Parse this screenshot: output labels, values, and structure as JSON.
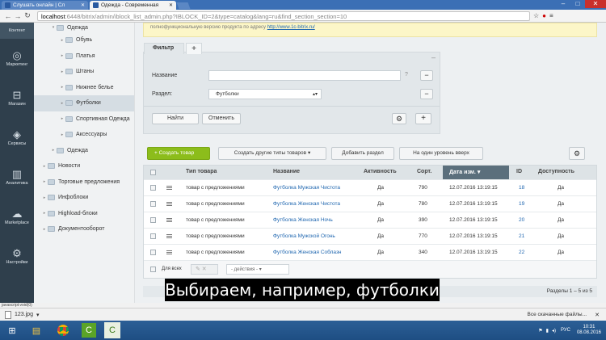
{
  "browser": {
    "tabs": [
      {
        "label": "Слушать онлайн | Сл",
        "active": false
      },
      {
        "label": "Одежда - Современная",
        "active": true
      }
    ],
    "url": "localhost:6448/bitrix/admin/iblock_list_admin.php?IBLOCK_ID=2&type=catalog&lang=ru&find_section_section=10",
    "url_host": "localhost",
    "url_rest": ":6448/bitrix/admin/iblock_list_admin.php?IBLOCK_ID=2&type=catalog&lang=ru&find_section_section=10"
  },
  "sidebar": {
    "items": [
      {
        "label": "Контент",
        "icon": "content-icon"
      },
      {
        "label": "Маркетинг",
        "icon": "target-icon"
      },
      {
        "label": "Магазин",
        "icon": "cart-icon"
      },
      {
        "label": "Сервисы",
        "icon": "layers-icon"
      },
      {
        "label": "Аналитика",
        "icon": "bar-chart-icon"
      },
      {
        "label": "Marketplace",
        "icon": "cloud-icon"
      },
      {
        "label": "Настройки",
        "icon": "gear-icon"
      }
    ]
  },
  "tree": {
    "items": [
      {
        "label": "Одежда",
        "indent": 2,
        "arrow": "▾"
      },
      {
        "label": "Обувь",
        "indent": 3,
        "arrow": "▸"
      },
      {
        "label": "Платья",
        "indent": 3,
        "arrow": "▸"
      },
      {
        "label": "Штаны",
        "indent": 3,
        "arrow": "▸"
      },
      {
        "label": "Нижнее белье",
        "indent": 3,
        "arrow": "▸"
      },
      {
        "label": "Футболки",
        "indent": 3,
        "arrow": "▸",
        "selected": true
      },
      {
        "label": "Спортивная Одежда",
        "indent": 3,
        "arrow": "▸"
      },
      {
        "label": "Аксессуары",
        "indent": 3,
        "arrow": "▸"
      },
      {
        "label": "Одежда",
        "indent": 2,
        "arrow": "▸"
      },
      {
        "label": "Новости",
        "indent": 1,
        "arrow": "▸"
      },
      {
        "label": "Торговые предложения",
        "indent": 1,
        "arrow": "▸"
      },
      {
        "label": "Инфоблоки",
        "indent": 1,
        "arrow": "▸"
      },
      {
        "label": "Highload-блоки",
        "indent": 1,
        "arrow": "▸"
      },
      {
        "label": "Документооборот",
        "indent": 1,
        "arrow": "▸"
      }
    ]
  },
  "notice": {
    "text": "полнофункциональную версию продукта по адресу",
    "link": "http://www.1c-bitrix.ru/"
  },
  "filter": {
    "tab_label": "Фильтр",
    "add_tab": "+",
    "name_label": "Название",
    "name_value": "",
    "help": "?",
    "section_label": "Раздел:",
    "section_value": "Футболки",
    "find_button": "Найти",
    "cancel_button": "Отменить",
    "remove": "−",
    "add": "+"
  },
  "toolbar": {
    "create": "Создать товар",
    "create_other": "Создать другие типы товаров",
    "add_section": "Добавить раздел",
    "level_up": "На один уровень вверх"
  },
  "grid": {
    "columns": [
      "Тип товара",
      "Название",
      "Активность",
      "Сорт.",
      "Дата изм.",
      "ID",
      "Доступность"
    ],
    "rows": [
      {
        "type": "товар с предложениями",
        "name": "Футболка Мужская Чистота",
        "active": "Да",
        "sort": "790",
        "date": "12.07.2016 13:19:15",
        "id": "18",
        "avail": "Да"
      },
      {
        "type": "товар с предложениями",
        "name": "Футболка Женская Чистота",
        "active": "Да",
        "sort": "780",
        "date": "12.07.2016 13:19:15",
        "id": "19",
        "avail": "Да"
      },
      {
        "type": "товар с предложениями",
        "name": "Футболка Женская Ночь",
        "active": "Да",
        "sort": "390",
        "date": "12.07.2016 13:19:15",
        "id": "20",
        "avail": "Да"
      },
      {
        "type": "товар с предложениями",
        "name": "Футболка Мужской Огонь",
        "active": "Да",
        "sort": "770",
        "date": "12.07.2016 13:19:15",
        "id": "21",
        "avail": "Да"
      },
      {
        "type": "товар с предложениями",
        "name": "Футболка Женская Соблазн",
        "active": "Да",
        "sort": "340",
        "date": "12.07.2016 13:19:15",
        "id": "22",
        "avail": "Да"
      }
    ],
    "for_all": "Для всех",
    "actions": "- действия -",
    "pager": "Разделы 1 – 5 из 5"
  },
  "subtitle": "Выбираем, например, футболки",
  "status": "javascript:void(0)",
  "download": {
    "file": "123.jpg",
    "all": "Все скачанные файлы..."
  },
  "taskbar": {
    "lang": "РУС",
    "time": "10:31",
    "date": "08.08.2016"
  }
}
